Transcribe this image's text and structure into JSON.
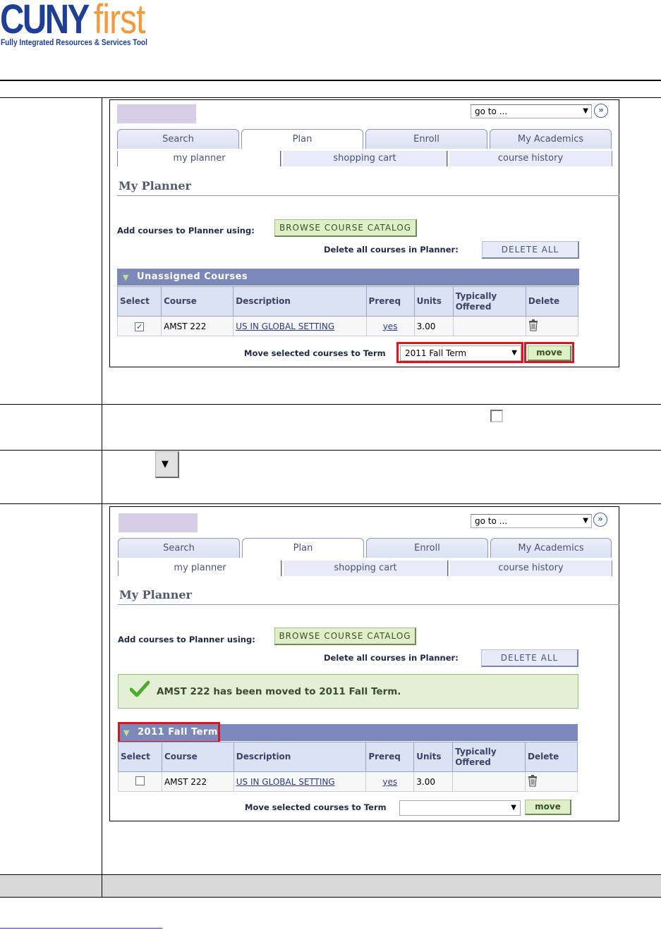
{
  "header": {
    "logo_cuny": "CUNY",
    "logo_first": "first",
    "logo_subtitle": "Fully Integrated Resources & Services Tool"
  },
  "screenshot_before": {
    "goto": {
      "value": "go to ..."
    },
    "tabs": [
      "Search",
      "Plan",
      "Enroll",
      "My Academics"
    ],
    "subtabs": [
      "my planner",
      "shopping cart",
      "course history"
    ],
    "title": "My Planner",
    "add_label": "Add courses to Planner using:",
    "browse_button": "BROWSE COURSE CATALOG",
    "delete_all_label": "Delete all courses in Planner:",
    "delete_all_button": "DELETE ALL",
    "grid_title": "Unassigned Courses",
    "columns": [
      "Select",
      "Course",
      "Description",
      "Prereq",
      "Units",
      "Typically Offered",
      "Delete"
    ],
    "rows": [
      {
        "selected": true,
        "course": "AMST 222",
        "description": "US IN GLOBAL SETTING",
        "prereq": "yes",
        "units": "3.00",
        "typically_offered": ""
      }
    ],
    "move_label": "Move selected courses to Term",
    "term_value": "2011 Fall Term",
    "move_button": "move"
  },
  "screenshot_after": {
    "goto": {
      "value": "go to ..."
    },
    "tabs": [
      "Search",
      "Plan",
      "Enroll",
      "My Academics"
    ],
    "subtabs": [
      "my planner",
      "shopping cart",
      "course history"
    ],
    "title": "My Planner",
    "add_label": "Add courses to Planner using:",
    "browse_button": "BROWSE COURSE CATALOG",
    "delete_all_label": "Delete all courses in Planner:",
    "delete_all_button": "DELETE ALL",
    "message": "AMST 222 has been moved to 2011 Fall Term.",
    "grid_title": "2011 Fall Term",
    "columns": [
      "Select",
      "Course",
      "Description",
      "Prereq",
      "Units",
      "Typically Offered",
      "Delete"
    ],
    "rows": [
      {
        "selected": false,
        "course": "AMST 222",
        "description": "US IN GLOBAL SETTING",
        "prereq": "yes",
        "units": "3.00",
        "typically_offered": ""
      }
    ],
    "move_label": "Move selected courses to Term",
    "term_value": "",
    "move_button": "move"
  },
  "icons": {
    "checkbox_unchecked": "checkbox-unchecked-icon",
    "dropdown_arrow": "dropdown-arrow-icon",
    "checkmark": "checkmark-icon",
    "trash": "trash-icon"
  },
  "colors": {
    "brand_blue": "#1e3f94",
    "brand_orange": "#f29a3a",
    "highlight_red": "#e0141c",
    "grid_header": "#7c88b9",
    "success_bg": "#e3f0d6"
  }
}
